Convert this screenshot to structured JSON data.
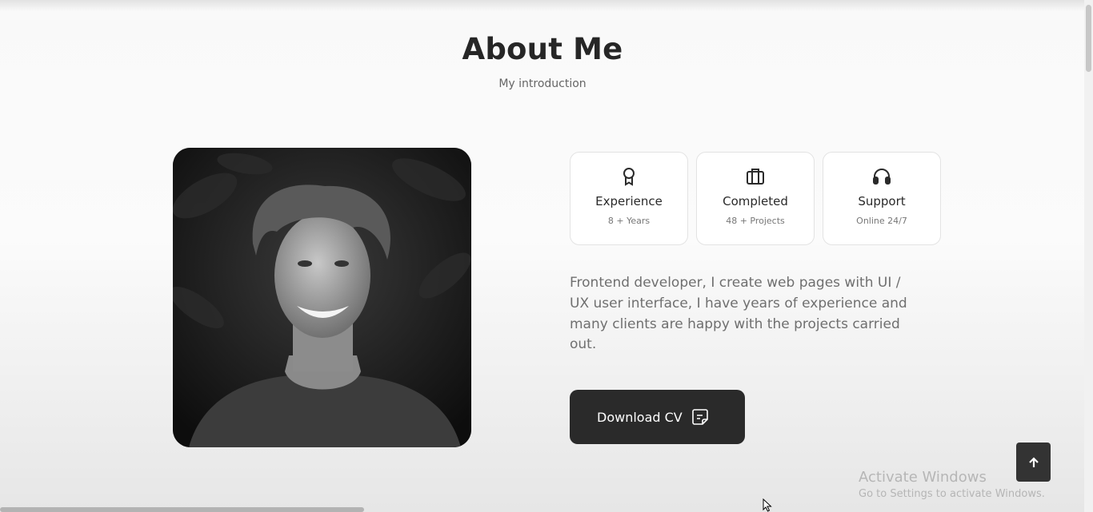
{
  "section": {
    "title": "About Me",
    "subtitle": "My introduction"
  },
  "stats": [
    {
      "title": "Experience",
      "value": "8 + Years",
      "icon": "award-icon"
    },
    {
      "title": "Completed",
      "value": "48 + Projects",
      "icon": "briefcase-icon"
    },
    {
      "title": "Support",
      "value": "Online 24/7",
      "icon": "headset-icon"
    }
  ],
  "description": "Frontend developer, I create web pages with UI / UX user interface, I have years of experience and many clients are happy with the projects carried out.",
  "download_button": {
    "label": "Download CV",
    "icon": "document-icon"
  },
  "scroll_top": {
    "icon": "arrow-up-icon"
  },
  "watermark": {
    "line1": "Activate Windows",
    "line2": "Go to Settings to activate Windows."
  },
  "colors": {
    "button_bg": "#2a2a2a",
    "card_bg": "#ffffff",
    "text_muted": "#6f6f6f"
  }
}
